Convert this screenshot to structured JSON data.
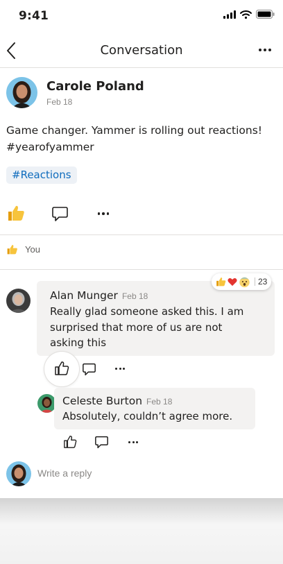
{
  "status_bar": {
    "time": "9:41"
  },
  "nav": {
    "title": "Conversation"
  },
  "post": {
    "author": "Carole Poland",
    "date": "Feb 18",
    "body": "Game changer. Yammer is rolling out reactions! #yearofyammer",
    "topic": "#Reactions",
    "reacted_by": "You"
  },
  "reaction_summary": {
    "count": "23"
  },
  "comments": [
    {
      "author": "Alan Munger",
      "date": "Feb 18",
      "text": "Really glad someone asked this. I am surprised that more of us are not asking this"
    },
    {
      "author": "Celeste Burton",
      "date": "Feb 18",
      "text": "Absolutely, couldn’t agree more."
    }
  ],
  "reply": {
    "placeholder": "Write a reply"
  },
  "icons": {
    "status": [
      "signal-icon",
      "wifi-icon",
      "battery-icon"
    ],
    "nav": [
      "back-icon",
      "more-icon"
    ],
    "actions": [
      "like-icon",
      "reply-icon",
      "more-icon"
    ],
    "reactions": [
      "like-reaction-icon",
      "heart-reaction-icon",
      "surprised-reaction-icon"
    ]
  },
  "colors": {
    "accent": "#0f6cbd",
    "like": "#f2b41b",
    "heart": "#e3342f",
    "bubble": "#f3f2f1"
  }
}
